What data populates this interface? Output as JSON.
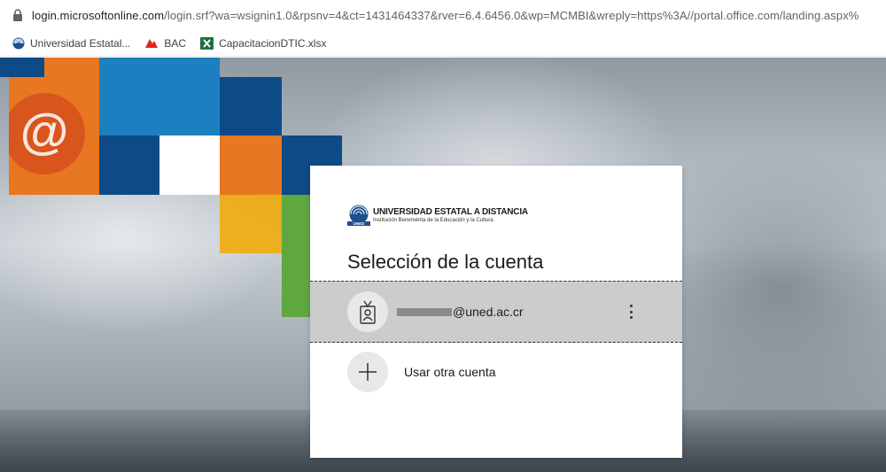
{
  "browser": {
    "url_host": "login.microsoftonline.com",
    "url_rest": "/login.srf?wa=wsignin1.0&rpsnv=4&ct=1431464337&rver=6.4.6456.0&wp=MCMBI&wreply=https%3A//portal.office.com/landing.aspx%",
    "bookmarks": [
      {
        "label": "Universidad Estatal...",
        "icon": "university-logo-icon"
      },
      {
        "label": "BAC",
        "icon": "bac-logo-icon"
      },
      {
        "label": "CapacitacionDTIC.xlsx",
        "icon": "excel-icon"
      }
    ]
  },
  "background": {
    "tile_colors": [
      "#0e4a86",
      "#e87722",
      "#f2a900",
      "#5fa83f",
      "#ffffff"
    ],
    "tile_symbol": "@"
  },
  "card": {
    "logo": {
      "name": "UNIVERSIDAD ESTATAL A DISTANCIA",
      "tagline": "Institución Benemérita de la Educación y la Cultura",
      "mark_text": "UNED"
    },
    "title": "Selección de la cuenta",
    "account": {
      "email_suffix": "@uned.ac.cr",
      "avatar_icon": "id-badge-icon"
    },
    "other_account_label": "Usar otra cuenta"
  }
}
